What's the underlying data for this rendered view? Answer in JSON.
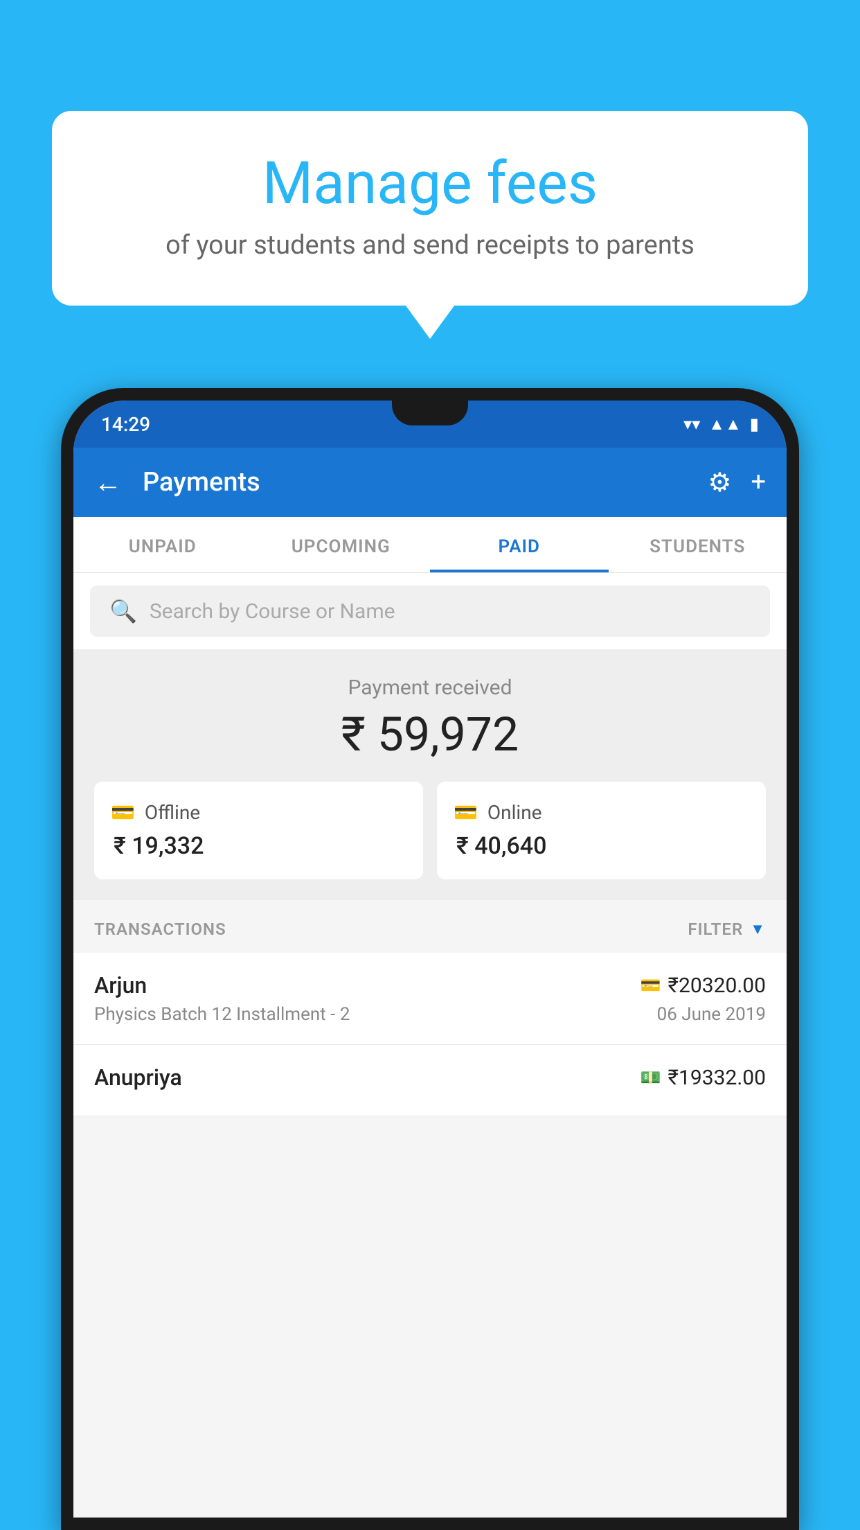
{
  "background_color": "#29B6F6",
  "bubble": {
    "title": "Manage fees",
    "subtitle": "of your students and send receipts to parents"
  },
  "status_bar": {
    "time": "14:29",
    "wifi": "wifi",
    "signal": "signal",
    "battery": "battery"
  },
  "app_bar": {
    "title": "Payments",
    "back_label": "←",
    "gear_label": "⚙",
    "plus_label": "+"
  },
  "tabs": [
    {
      "label": "UNPAID",
      "active": false
    },
    {
      "label": "UPCOMING",
      "active": false
    },
    {
      "label": "PAID",
      "active": true
    },
    {
      "label": "STUDENTS",
      "active": false
    }
  ],
  "search": {
    "placeholder": "Search by Course or Name"
  },
  "payment_received": {
    "label": "Payment received",
    "amount": "₹ 59,972",
    "offline": {
      "label": "Offline",
      "amount": "₹ 19,332"
    },
    "online": {
      "label": "Online",
      "amount": "₹ 40,640"
    }
  },
  "transactions": {
    "header": "TRANSACTIONS",
    "filter_label": "FILTER",
    "rows": [
      {
        "name": "Arjun",
        "description": "Physics Batch 12 Installment - 2",
        "amount": "₹20320.00",
        "date": "06 June 2019",
        "type": "online"
      },
      {
        "name": "Anupriya",
        "description": "",
        "amount": "₹19332.00",
        "date": "",
        "type": "offline"
      }
    ]
  }
}
